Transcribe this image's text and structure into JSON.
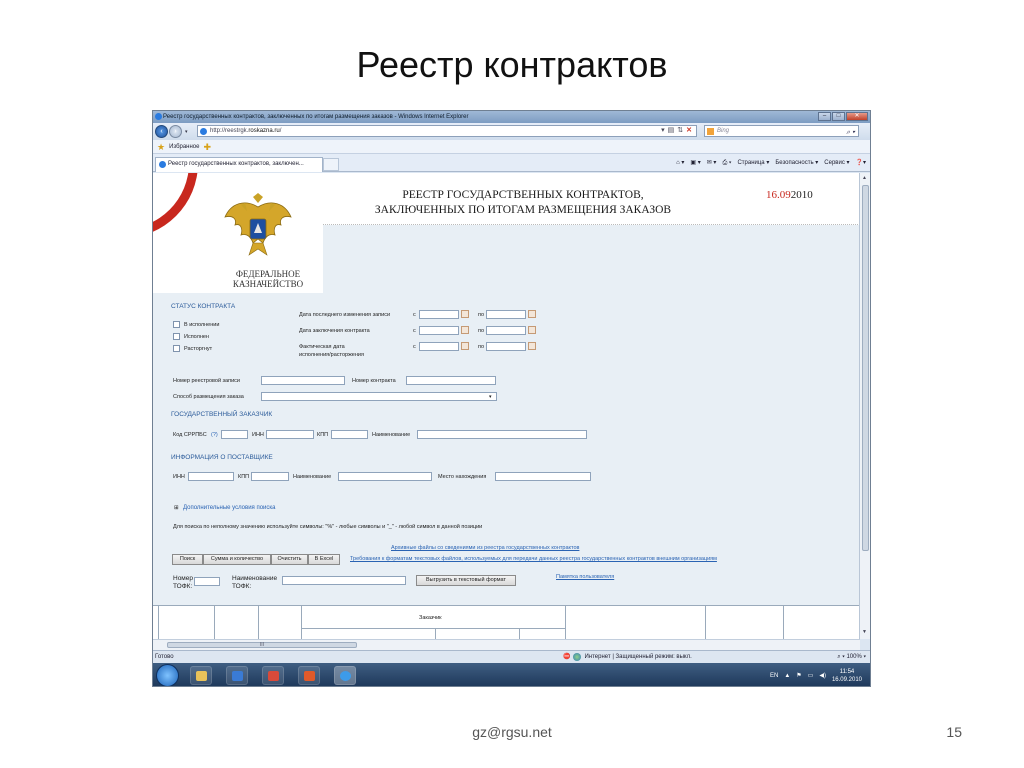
{
  "slide": {
    "title": "Реестр контрактов",
    "footer": "gz@rgsu.net",
    "page_number": "15"
  },
  "browser": {
    "window_title": "Реестр государственных контрактов, заключенных по итогам размещения заказов - Windows Internet Explorer",
    "url_prefix": "http://reestrgk.",
    "url_domain": "roskazna.ru",
    "url_suffix": "/",
    "search_placeholder": "Bing",
    "favorites_label": "Избранное",
    "tab_label": "Реестр государственных контрактов, заключен...",
    "command_bar": [
      "Страница ▾",
      "Безопасность ▾",
      "Сервис ▾"
    ],
    "status_left": "Готово",
    "status_mid": "Интернет | Защищенный режим: выкл.",
    "zoom": "100%",
    "hscroll_label": "III"
  },
  "taskbar": {
    "lang": "EN",
    "time": "11:54",
    "date": "16.09.2010"
  },
  "page": {
    "title_line1": "РЕЕСТР ГОСУДАРСТВЕННЫХ КОНТРАКТОВ,",
    "title_line2": "ЗАКЛЮЧЕННЫХ ПО ИТОГАМ РАЗМЕЩЕНИЯ ЗАКАЗОВ",
    "date_red": "16.09",
    "date_rest": "2010",
    "org_line1": "ФЕДЕРАЛЬНОЕ",
    "org_line2": "КАЗНАЧЕЙСТВО",
    "status_section": "СТАТУС КОНТРАКТА",
    "status_options": [
      "В исполнении",
      "Исполнен",
      "Расторгнут"
    ],
    "date_fields": {
      "last_change": "Дата последнего изменения записи",
      "conclusion": "Дата заключения контракта",
      "actual_line1": "Фактическая дата",
      "actual_line2": "исполнения/расторжения",
      "from": "с",
      "to": "по"
    },
    "registry_number": "Номер реестровой записи",
    "contract_number": "Номер контракта",
    "placement_method": "Способ размещения заказа",
    "customer_section": "ГОСУДАРСТВЕННЫЙ ЗАКАЗЧИК",
    "customer_fields": {
      "code": "Код СРРПБС",
      "help": "(?)",
      "inn": "ИНН",
      "kpp": "КПП",
      "name": "Наименование"
    },
    "supplier_section": "ИНФОРМАЦИЯ О ПОСТАВЩИКЕ",
    "supplier_fields": {
      "inn": "ИНН",
      "kpp": "КПП",
      "name": "Наименование",
      "location": "Место нахождения"
    },
    "extra_conditions": "Дополнительные условия поиска",
    "hint": "Для поиска по неполному значению используйте символы: \"%\" - любые символы и \"_\" - любой символ в данной позиции",
    "archive_link": "Архивные файлы со сведениями из реестра государственных контрактов",
    "format_link": "Требования к форматам текстовых файлов, используемых для передачи данных реестра государственных контрактов внешним организациям",
    "buttons": {
      "search": "Поиск",
      "sum": "Сумма и количество",
      "clear": "Очистить",
      "excel": "В Excel",
      "export": "Выгрузить в текстовый формат"
    },
    "tofk_number_line1": "Номер",
    "tofk_number_line2": "ТОФК:",
    "tofk_name_line1": "Наименование",
    "tofk_name_line2": "ТОФК:",
    "user_memo": "Памятка пользователя",
    "table_header": "Заказчик"
  }
}
